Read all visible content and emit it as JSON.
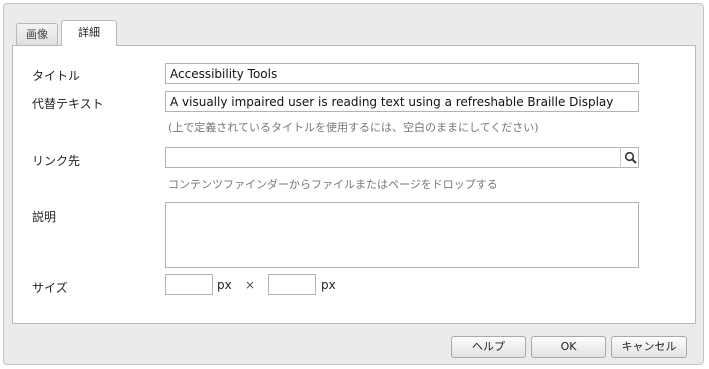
{
  "tabs": [
    {
      "label": "画像"
    },
    {
      "label": "詳細"
    }
  ],
  "form": {
    "title": {
      "label": "タイトル",
      "value": "Accessibility Tools"
    },
    "alt_text": {
      "label": "代替テキスト",
      "value": "A visually impaired user is reading text using a refreshable Braille Display",
      "hint": "(上で定義されているタイトルを使用するには、空白のままにしてください)"
    },
    "link": {
      "label": "リンク先",
      "value": "",
      "hint": "コンテンツファインダーからファイルまたはページをドロップする",
      "icon": "search-icon"
    },
    "description": {
      "label": "説明",
      "value": ""
    },
    "size": {
      "label": "サイズ",
      "width": "",
      "height": "",
      "unit": "px",
      "separator": "×"
    }
  },
  "buttons": {
    "help": "ヘルプ",
    "ok": "OK",
    "cancel": "キャンセル"
  }
}
